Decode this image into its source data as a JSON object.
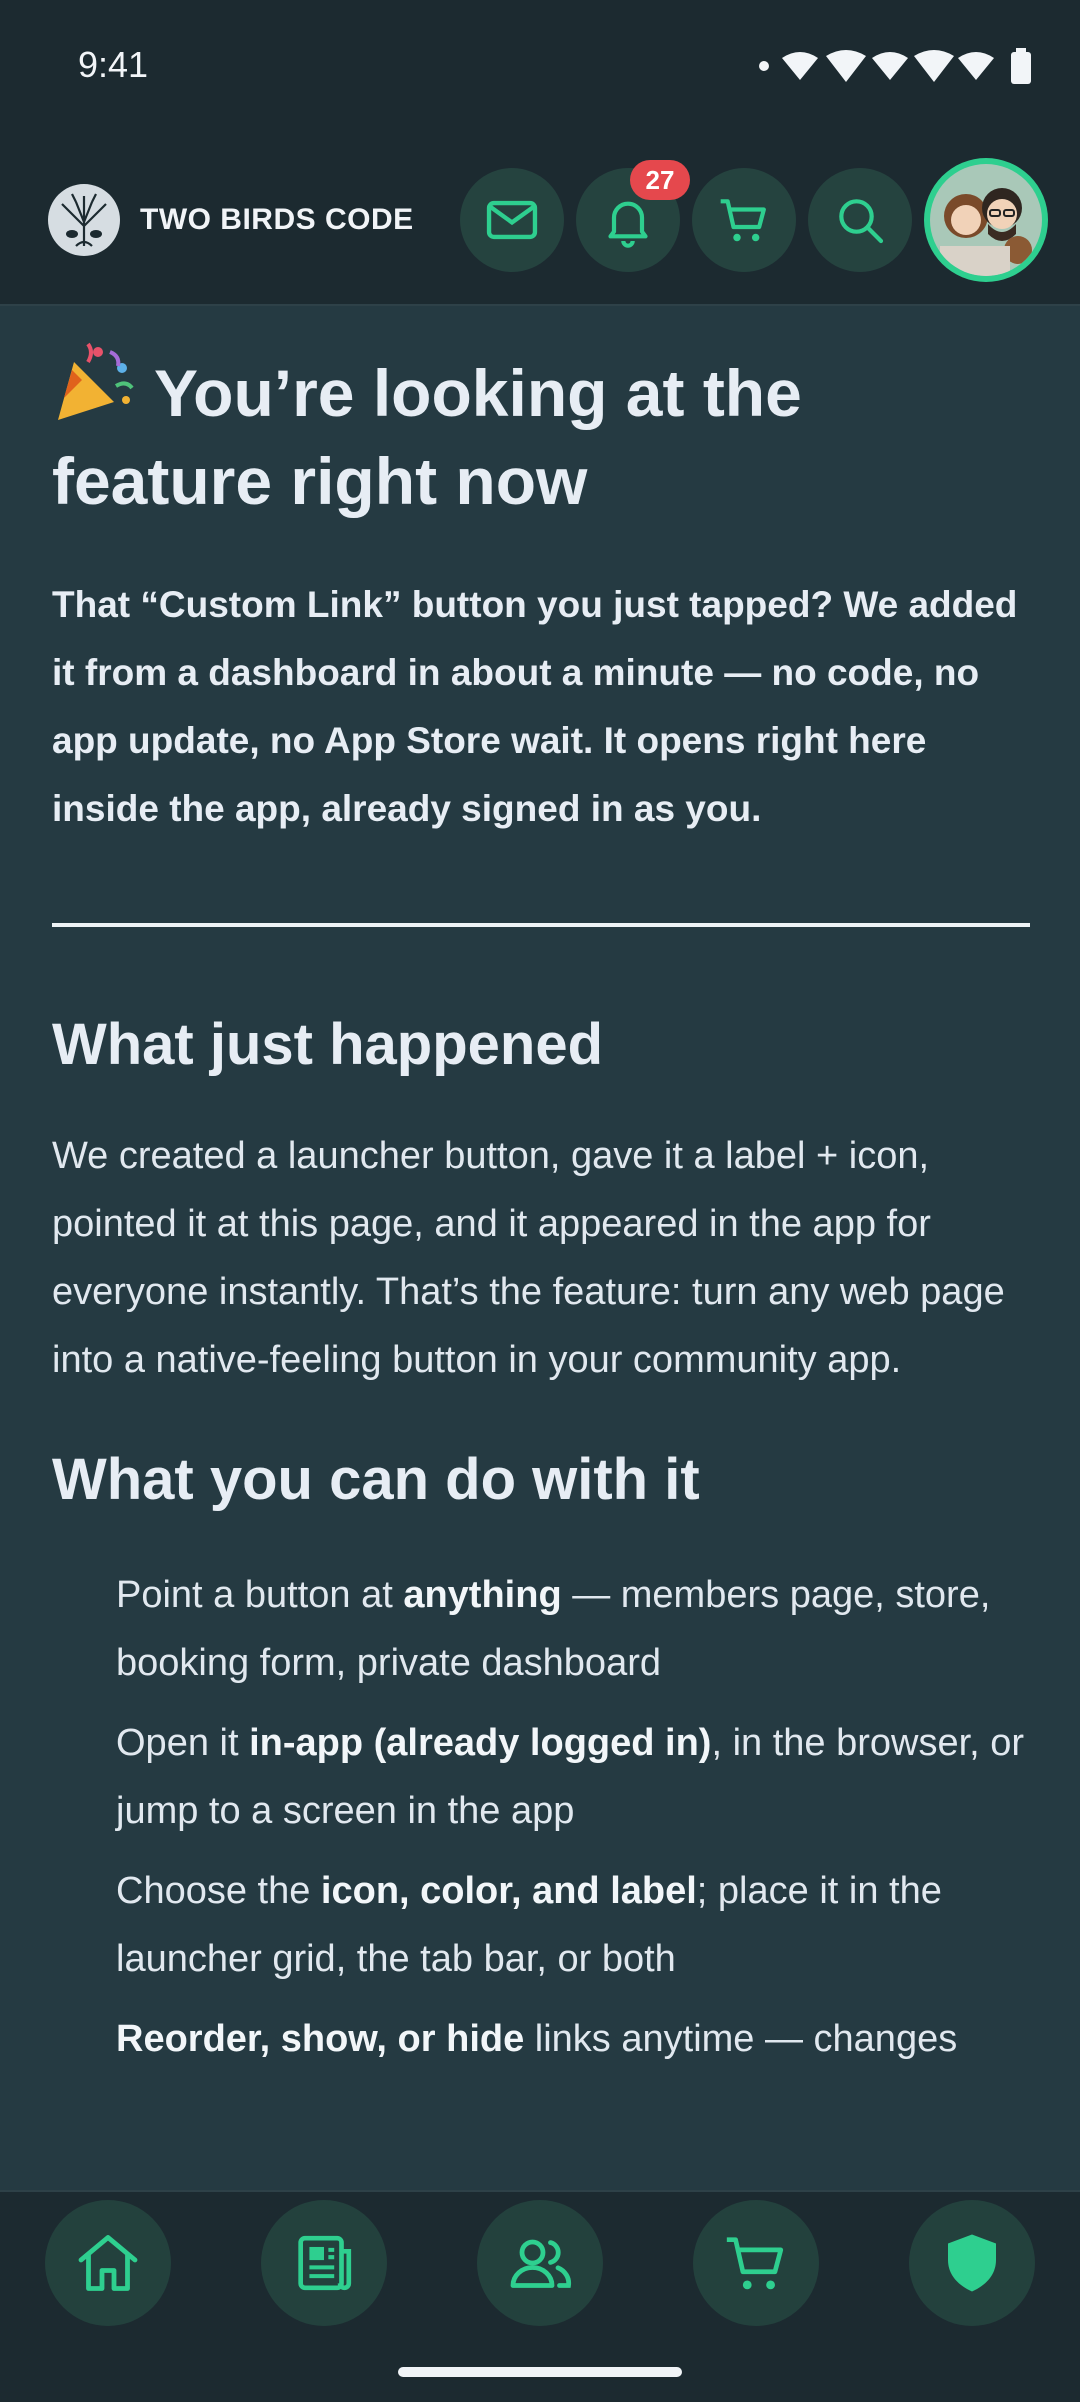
{
  "status_bar": {
    "time": "9:41"
  },
  "header": {
    "brand": "TWO BIRDS CODE",
    "notification_count": "27"
  },
  "article": {
    "title": "You’re looking at the feature right now",
    "lead": "That “Custom Link” button you just tapped? We added it from a dashboard in about a minute — no code, no app update, no App Store wait. It opens right here inside the app, already signed in as you.",
    "section1_heading": "What just happened",
    "section1_body": "We created a launcher button, gave it a label + icon, pointed it at this page, and it appeared in the app for everyone instantly. That’s the feature: turn any web page into a native-feeling button in your community app.",
    "section2_heading": "What you can do with it",
    "list": [
      {
        "pre": "Point a button at ",
        "bold": "anything",
        "post": " — members page, store, booking form, private dashboard"
      },
      {
        "pre": "Open it ",
        "bold": "in-app (already logged in)",
        "post": ", in the browser, or jump to a screen in the app"
      },
      {
        "pre": "Choose the ",
        "bold": "icon, color, and label",
        "post": "; place it in the launcher grid, the tab bar, or both"
      },
      {
        "pre": "",
        "bold": "Reorder, show, or hide",
        "post": " links anytime — changes"
      }
    ]
  },
  "icons": {
    "header": [
      "mail-icon",
      "bell-icon",
      "cart-icon",
      "search-icon"
    ],
    "nav": [
      "home-icon",
      "news-icon",
      "members-icon",
      "cart-icon",
      "shield-icon"
    ]
  },
  "colors": {
    "background": "#253a42",
    "bar": "#1c2a30",
    "accent": "#2ecf8f",
    "button": "#25433f",
    "badge": "#e5484d"
  }
}
